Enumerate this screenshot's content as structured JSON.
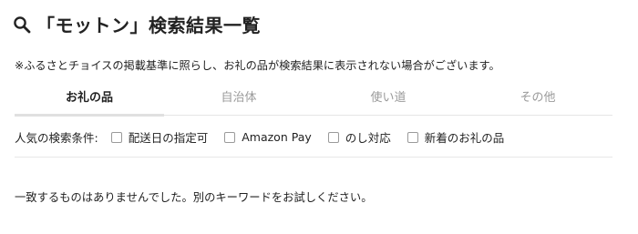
{
  "header": {
    "title": "「モットン」検索結果一覧",
    "icon": "search-icon"
  },
  "notice": "※ふるさとチョイスの掲載基準に照らし、お礼の品が検索結果に表示されない場合がございます。",
  "tabs": [
    {
      "label": "お礼の品",
      "active": true
    },
    {
      "label": "自治体",
      "active": false
    },
    {
      "label": "使い道",
      "active": false
    },
    {
      "label": "その他",
      "active": false
    }
  ],
  "filters": {
    "label": "人気の検索条件:",
    "options": [
      {
        "label": "配送日の指定可",
        "checked": false
      },
      {
        "label": "Amazon Pay",
        "checked": false
      },
      {
        "label": "のし対応",
        "checked": false
      },
      {
        "label": "新着のお礼の品",
        "checked": false
      }
    ]
  },
  "results": {
    "empty_message": "一致するものはありませんでした。別のキーワードをお試しください。"
  },
  "colors": {
    "text": "#222222",
    "muted": "#9a9a9a",
    "divider": "#e5e5e5"
  }
}
